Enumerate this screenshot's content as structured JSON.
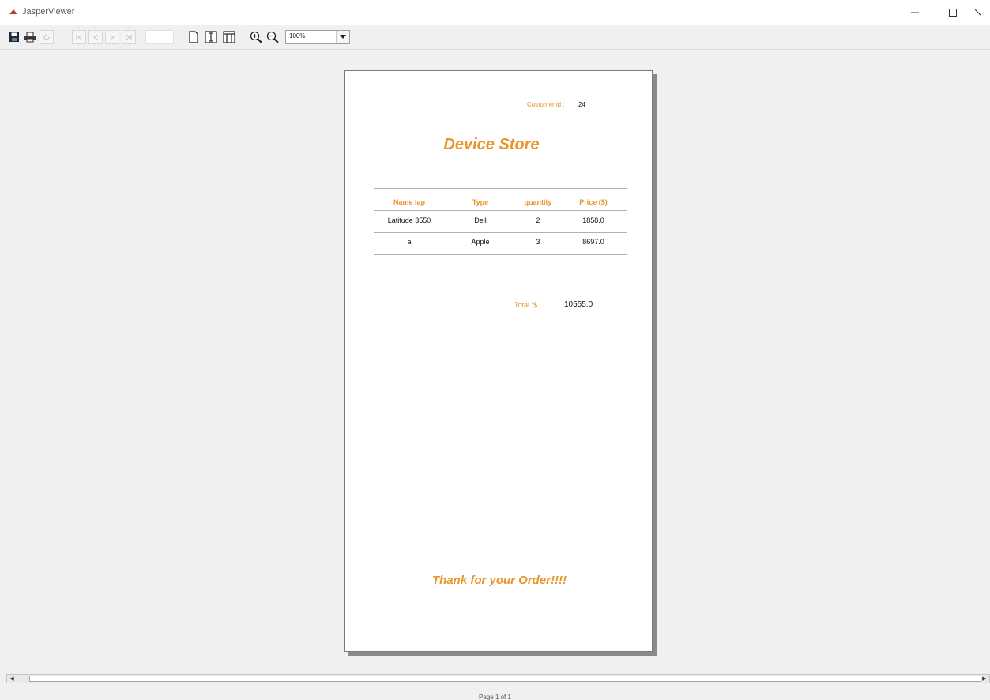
{
  "window": {
    "title": "JasperViewer",
    "icons": {
      "app": "java-cup-icon",
      "minimize": "minimize-icon",
      "maximize": "maximize-icon",
      "close": "close-icon"
    }
  },
  "toolbar": {
    "zoom": "100%",
    "page_input": ""
  },
  "report": {
    "customer_label": "Customer id :",
    "customer_value": "24",
    "store_title": "Device Store",
    "columns": [
      "Name lap",
      "Type",
      "quantity",
      "Price ($)"
    ],
    "rows": [
      [
        "Latitude 3550",
        "Dell",
        "2",
        "1858.0"
      ],
      [
        "a",
        "Apple",
        "3",
        "8697.0"
      ]
    ],
    "total_label": "Total :$",
    "total_value": "10555.0",
    "thanks": "Thank for your Order!!!!"
  },
  "status": {
    "page_info": "Page 1 of 1"
  },
  "colors": {
    "accent": "#e8952c",
    "background": "#f0f0f0"
  }
}
